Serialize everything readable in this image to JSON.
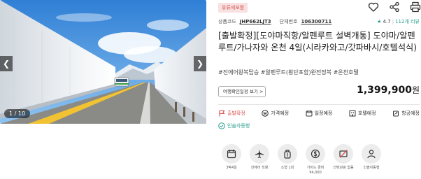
{
  "carousel": {
    "counter": "1 / 10",
    "prev_icon": "chevron-left-icon",
    "next_icon": "chevron-right-icon"
  },
  "product": {
    "badge": "유류세포함",
    "code_label": "상품코드",
    "code_value": "JHP662LJT3",
    "group_label": "단체번호",
    "group_value": "106300711",
    "rating": "4.7",
    "reviews": "112개 리뷰",
    "title": "[출발확정][도야마직항/알펜루트 설벽개통] 도야마/알펜루트/가나자와 온천 4일(시라카와고/갓파바시/호텔석식)",
    "tags": "#진에어왕복탑승 #알펜루트(횡단포함)완전정복 #온천호텔",
    "calendar_button": "여행확인일정 보기 >",
    "price": "1,399,900",
    "price_unit": "원"
  },
  "top_icons": [
    "heart-icon",
    "share-icon",
    "print-icon"
  ],
  "menu": [
    {
      "label": "출발확정",
      "icon": "flag-icon"
    },
    {
      "label": "가격예정",
      "icon": "won-icon"
    },
    {
      "label": "일정예정",
      "icon": "calendar-icon"
    },
    {
      "label": "호텔예정",
      "icon": "hotel-icon"
    },
    {
      "label": "항공예정",
      "icon": "flight-icon"
    }
  ],
  "guide": {
    "label": "인솔자동행",
    "icon": "check-circle-icon"
  },
  "features": [
    {
      "label": "3박4일",
      "icon": "calendar-icon"
    },
    {
      "label": "진에어 직항",
      "icon": "airplane-icon"
    },
    {
      "label": "소형 1회",
      "icon": "luggage-icon"
    },
    {
      "label": "가이드 경비 ¥4,000",
      "icon": "coin-icon"
    },
    {
      "label": "선택관광 없음",
      "icon": "no-ticket-icon"
    },
    {
      "label": "인솔자동행",
      "icon": "person-icon"
    }
  ],
  "colors": {
    "accent": "#d9534f",
    "teal": "#2a9d8f",
    "badge_bg": "#f7e1e1"
  }
}
